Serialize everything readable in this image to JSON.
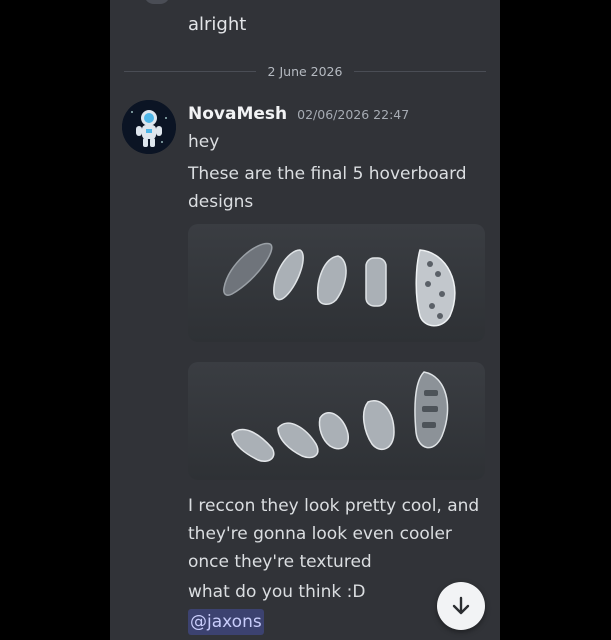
{
  "chat": {
    "previous_message": "alright",
    "date_divider": "2 June 2026",
    "message": {
      "username": "NovaMesh",
      "timestamp": "02/06/2026 22:47",
      "lines": [
        "hey",
        "These are the final 5 hoverboard designs"
      ],
      "after_attachments": [
        "I reccon they look pretty cool, and they're gonna look even cooler once they're textured",
        "what do you think :D"
      ],
      "mention": "@jaxons"
    }
  },
  "icons": {
    "avatar": "astronaut-avatar",
    "scroll": "arrow-down-icon"
  },
  "colors": {
    "background": "#313338",
    "text": "#dbdee1",
    "mention_bg": "#3c4270",
    "mention_text": "#c9cdfb"
  }
}
